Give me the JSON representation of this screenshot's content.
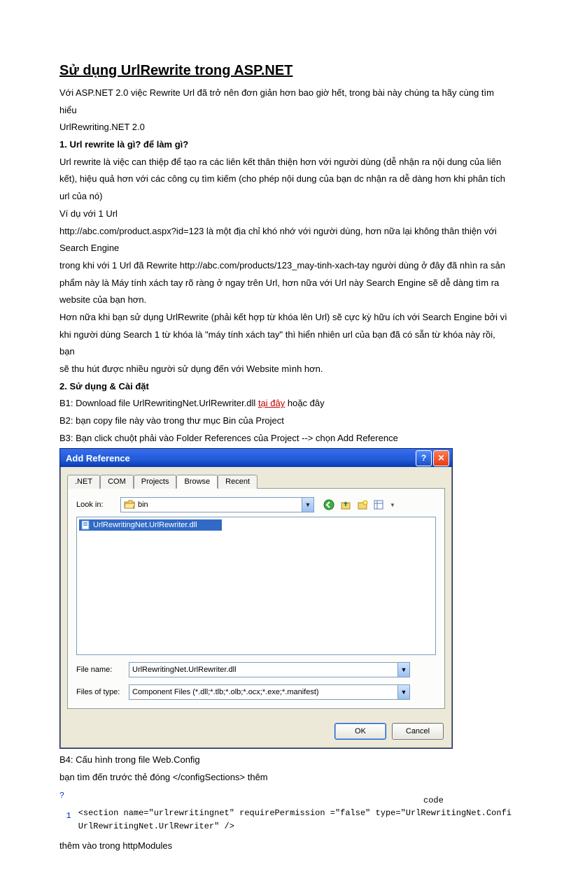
{
  "title": "Sử dụng UrlRewrite trong ASP.NET",
  "intro1": "Với ASP.NET 2.0 việc Rewrite Url đã trở nên đơn giản hơn bao giờ hết, trong bài này chúng ta hãy cùng tìm hiểu",
  "intro2": "UrlRewriting.NET 2.0",
  "h1": "1. Url rewrite là gì? để làm gì?",
  "p1a": "Url rewrite là việc can thiệp để tạo ra các liên kết thân thiện hơn với người dùng (dễ nhận ra nội dung của liên",
  "p1b": "kết), hiệu quả hơn với các công cụ tìm kiếm (cho phép nội dung của bạn dc nhận ra dễ dàng hơn khi phân tích",
  "p1c": "url của nó)",
  "p2": "Ví dụ với 1 Url",
  "p3a": "http://abc.com/product.aspx?id=123 là một địa chỉ khó nhớ với người dùng, hơn nữa lại không thân thiện với",
  "p3b": "Search Engine",
  "p4a": "trong khi với 1 Url đã Rewrite http://abc.com/products/123_may-tinh-xach-tay người dùng ở đây đã nhìn ra sản",
  "p4b": "phẩm này là Máy tính xách tay rõ ràng ở ngay trên Url, hơn nữa với Url này Search Engine sẽ dễ dàng tìm ra",
  "p4c": "website của bạn hơn.",
  "p5a": "Hơn nữa khi bạn sử dụng UrlRewrite (phải kết hợp từ khóa lên Url) sẽ cực kỳ hữu ích với Search Engine bởi vì",
  "p5b": "khi người dùng Search 1 từ khóa là \"máy tính xách tay\" thì hiển nhiên url của bạn đã có sẵn từ khóa này rồi, bạn",
  "p5c": "sẽ thu hút được nhiều người sử dụng đến với Website mình hơn.",
  "h2": "2. Sử dụng & Cài đặt",
  "b1_pre": "B1: Download file UrlRewritingNet.UrlRewriter.dll ",
  "b1_link": "tại đây",
  "b1_post": " hoặc đây",
  "b2": "B2: bạn copy file này vào trong thư mục Bin của Project",
  "b3": "B3: Bạn click chuột phải vào Folder References của Project --> chọn Add Reference",
  "dialog": {
    "title": "Add Reference",
    "tabs": [
      ".NET",
      "COM",
      "Projects",
      "Browse",
      "Recent"
    ],
    "lookin_label": "Look in:",
    "lookin_value": "bin",
    "selected_file": "UrlRewritingNet.UrlRewriter.dll",
    "filename_label": "File name:",
    "filename_value": "UrlRewritingNet.UrlRewriter.dll",
    "filetype_label": "Files of type:",
    "filetype_value": "Component Files (*.dll;*.tlb;*.olb;*.ocx;*.exe;*.manifest)",
    "ok": "OK",
    "cancel": "Cancel"
  },
  "b4": "B4: Cấu hình trong file Web.Config",
  "b5": "bạn tìm đến trước thẻ đóng </configSections> thêm",
  "qmark": "?",
  "code_label": "code",
  "code_num": "1",
  "code_l1": "<section name=\"urlrewritingnet\" requirePermission =\"false\" type=\"UrlRewritingNet.Confi",
  "code_l2": "UrlRewritingNet.UrlRewriter\" />",
  "b6": "thêm vào trong httpModules"
}
